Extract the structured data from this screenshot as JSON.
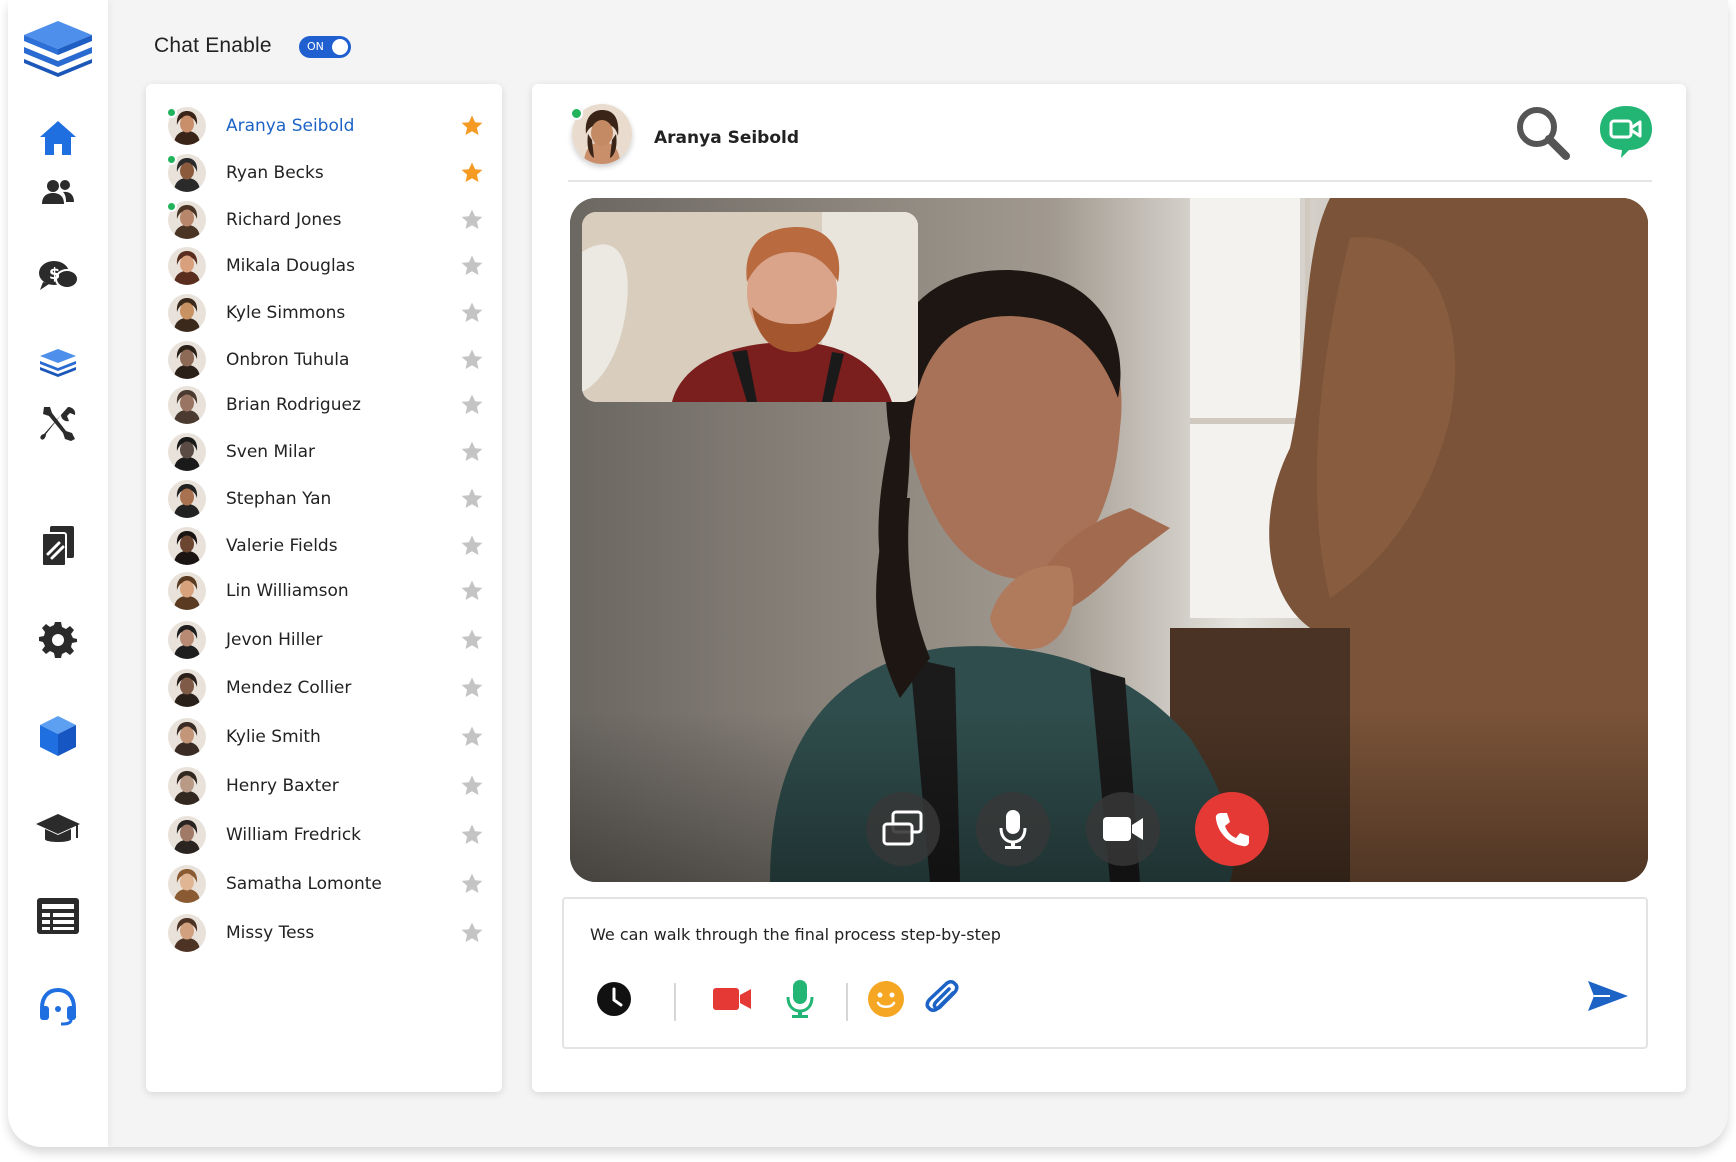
{
  "header": {
    "chat_enable_label": "Chat Enable",
    "toggle_label": "ON"
  },
  "sidebar": {
    "icons": [
      "logo-stack-icon",
      "home-icon",
      "users-icon",
      "dollar-chat-icon",
      "layers-icon",
      "tools-icon",
      "documents-icon",
      "settings-icon",
      "cube-icon",
      "graduation-cap-icon",
      "news-list-icon",
      "headset-icon"
    ]
  },
  "contacts": [
    {
      "name": "Aranya Seibold",
      "online": true,
      "starred": true,
      "active": true
    },
    {
      "name": "Ryan Becks",
      "online": true,
      "starred": true,
      "active": false
    },
    {
      "name": "Richard Jones",
      "online": true,
      "starred": false,
      "active": false
    },
    {
      "name": "Mikala Douglas",
      "online": false,
      "starred": false,
      "active": false
    },
    {
      "name": "Kyle Simmons",
      "online": false,
      "starred": false,
      "active": false
    },
    {
      "name": "Onbron Tuhula",
      "online": false,
      "starred": false,
      "active": false
    },
    {
      "name": "Brian Rodriguez",
      "online": false,
      "starred": false,
      "active": false
    },
    {
      "name": "Sven Milar",
      "online": false,
      "starred": false,
      "active": false
    },
    {
      "name": "Stephan Yan",
      "online": false,
      "starred": false,
      "active": false
    },
    {
      "name": "Valerie Fields",
      "online": false,
      "starred": false,
      "active": false
    },
    {
      "name": "Lin Williamson",
      "online": false,
      "starred": false,
      "active": false
    },
    {
      "name": "Jevon Hiller",
      "online": false,
      "starred": false,
      "active": false
    },
    {
      "name": "Mendez Collier",
      "online": false,
      "starred": false,
      "active": false
    },
    {
      "name": "Kylie Smith",
      "online": false,
      "starred": false,
      "active": false
    },
    {
      "name": "Henry Baxter",
      "online": false,
      "starred": false,
      "active": false
    },
    {
      "name": "William Fredrick",
      "online": false,
      "starred": false,
      "active": false
    },
    {
      "name": "Samatha Lomonte",
      "online": false,
      "starred": false,
      "active": false
    },
    {
      "name": "Missy Tess",
      "online": false,
      "starred": false,
      "active": false
    }
  ],
  "conversation": {
    "contact_name": "Aranya Seibold",
    "online": true
  },
  "call_controls": [
    "switch-screen-icon",
    "microphone-icon",
    "camera-icon",
    "hang-up-icon"
  ],
  "composer": {
    "message": "We can walk through the final process step-by-step",
    "tools": [
      "clock-icon",
      "video-record-icon",
      "mic-record-icon",
      "emoji-icon",
      "attach-icon"
    ],
    "send_icon": "send-icon"
  },
  "colors": {
    "accent_blue": "#1d63c6",
    "star_active": "#f59a23",
    "star_inactive": "#c4c4c4",
    "online_green": "#21b35b",
    "hangup_red": "#e53935",
    "video_green": "#22b573"
  }
}
